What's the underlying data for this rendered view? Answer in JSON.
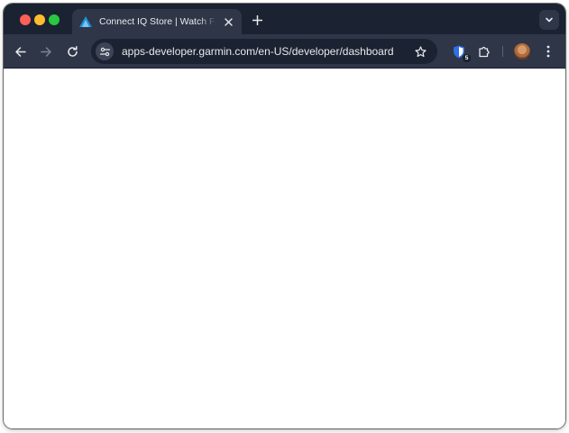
{
  "window": {
    "tab": {
      "title": "Connect IQ Store | Watch Faces",
      "favicon": "garmin-triangle-icon",
      "close_icon": "close-icon"
    },
    "new_tab_icon": "plus-icon",
    "tab_search_icon": "chevron-down-icon"
  },
  "toolbar": {
    "back_icon": "arrow-left-icon",
    "forward_icon": "arrow-right-icon",
    "reload_icon": "reload-icon",
    "site_info_icon": "tune-icon",
    "url": "apps-developer.garmin.com/en-US/developer/dashboard",
    "bookmark_icon": "star-icon",
    "extension_badge": "5",
    "extensions_icon": "puzzle-icon",
    "menu_icon": "kebab-menu-icon"
  },
  "colors": {
    "tabstrip_bg": "#1b2231",
    "toolbar_bg": "#2e3648",
    "text": "#e8eaed",
    "close_red": "#fe5f57",
    "minimize_yellow": "#febc2e",
    "zoom_green": "#28c840",
    "page_bg": "#ffffff"
  }
}
